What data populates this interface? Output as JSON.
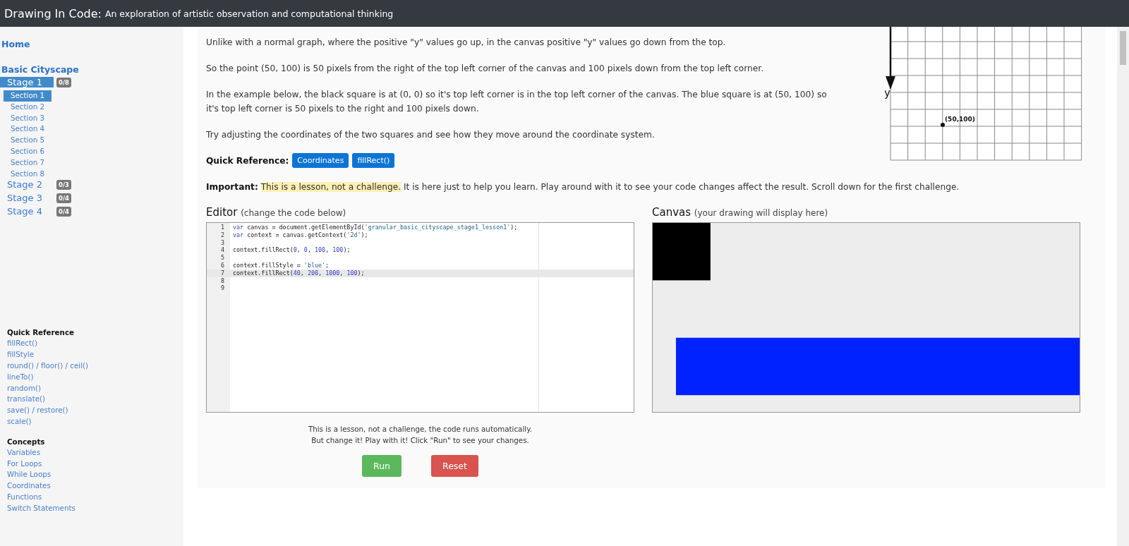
{
  "header": {
    "title": "Drawing In Code:",
    "subtitle": "An exploration of artistic observation and computational thinking"
  },
  "sidebar": {
    "home": "Home",
    "course": "Basic Cityscape",
    "stages": [
      {
        "label": "Stage 1",
        "badge": "0/8",
        "selected": true,
        "sections": [
          {
            "label": "Section 1",
            "selected": true
          },
          {
            "label": "Section 2",
            "selected": false
          },
          {
            "label": "Section 3",
            "selected": false
          },
          {
            "label": "Section 4",
            "selected": false
          },
          {
            "label": "Section 5",
            "selected": false
          },
          {
            "label": "Section 6",
            "selected": false
          },
          {
            "label": "Section 7",
            "selected": false
          },
          {
            "label": "Section 8",
            "selected": false
          }
        ]
      },
      {
        "label": "Stage 2",
        "badge": "0/3",
        "selected": false
      },
      {
        "label": "Stage 3",
        "badge": "0/4",
        "selected": false
      },
      {
        "label": "Stage 4",
        "badge": "0/4",
        "selected": false
      }
    ],
    "groups": [
      {
        "title": "Quick Reference",
        "links": [
          "fillRect()",
          "fillStyle",
          "round() / floor() / ceil()",
          "lineTo()",
          "random()",
          "translate()",
          "save() / restore()",
          "scale()"
        ]
      },
      {
        "title": "Concepts",
        "links": [
          "Variables",
          "For Loops",
          "While Loops",
          "Coordinates",
          "Functions",
          "Switch Statements"
        ]
      }
    ]
  },
  "lesson": {
    "paragraphs": [
      "Unlike with a normal graph, where the positive \"y\" values go up, in the canvas positive \"y\" values go down from the top.",
      "So the point (50, 100) is 50 pixels from the right of the top left corner of the canvas and 100 pixels down from the top left corner.",
      "In the example below, the black square is at (0, 0) so it's top left corner is in the top left corner of the canvas. The blue square is at (50, 100) so it's top left corner is 50 pixels to the right and 100 pixels down.",
      "Try adjusting the coordinates of the two squares and see how they move around the coordinate system."
    ],
    "figure": {
      "axis_label": "y",
      "point_label": "(50,100)"
    },
    "quick_reference": {
      "label": "Quick Reference:",
      "buttons": [
        "Coordinates",
        "fillRect()"
      ]
    },
    "important": {
      "label": "Important:",
      "highlight": "This is a lesson, not a challenge.",
      "text": "It is here just to help you learn. Play around with it to see your code changes affect the result. Scroll down for the first challenge."
    }
  },
  "editor": {
    "title": "Editor",
    "hint": "(change the code below)",
    "lines": [
      {
        "number": "1",
        "code": "var canvas = document.getElementById('granular_basic_cityscape_stage1_lesson1');",
        "selected": false
      },
      {
        "number": "2",
        "code": "var context = canvas.getContext('2d');",
        "selected": false
      },
      {
        "number": "3",
        "selected": false
      },
      {
        "number": "4",
        "code": "context.fillRect(0, 0, 100, 100);",
        "selected": false
      },
      {
        "number": "5",
        "selected": false
      },
      {
        "number": "6",
        "code": "context.fillStyle = 'blue';",
        "selected": false
      },
      {
        "number": "7",
        "code": "context.fillRect(40, 200, 1000, 100);",
        "selected": true
      },
      {
        "number": "8",
        "selected": false
      },
      {
        "number": "9",
        "selected": false
      }
    ]
  },
  "canvas": {
    "title": "Canvas",
    "hint": "(your drawing will display here)"
  },
  "notice": [
    "This is a lesson, not a challenge, the code runs automatically.",
    "But change it! Play with it! Click \"Run\" to see your changes."
  ],
  "buttons": [
    {
      "label": "Run",
      "kind": "run"
    },
    {
      "label": "Reset",
      "kind": "reset"
    }
  ]
}
